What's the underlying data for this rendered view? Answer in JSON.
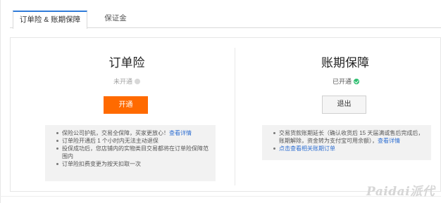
{
  "tabs": [
    {
      "label": "订单险 & 账期保障",
      "active": true
    },
    {
      "label": "保证金",
      "active": false
    }
  ],
  "order_insurance": {
    "title": "订单险",
    "status": "未开通",
    "button": "开通",
    "bullets": {
      "b1_text": "保险公司护航，交易全保障，买家更放心！",
      "b1_link": "查看详情",
      "b2": "订单险开通后 1 个小时内无法主动退保",
      "b3": "投保成功后，您店铺内的实物类目交易都将在订单险保障范围内",
      "b4": "订单险扣费变更为按天扣取一次"
    }
  },
  "period_protection": {
    "title": "账期保障",
    "status": "已开通",
    "button": "退出",
    "bullets": {
      "b1_text": "交易货款账期延长（确认收货后 15 天届满或售后完成后，账期解除，资金转为支付宝可用余额），",
      "b1_link": "查看详情",
      "b2_link": "点击查看相关账期订单"
    }
  },
  "watermark": "Paidai派代",
  "colors": {
    "accent": "#ff6a00",
    "tab_active_border": "#2f7bd9",
    "link": "#2f6fd1",
    "status_on": "#2fbf71"
  }
}
